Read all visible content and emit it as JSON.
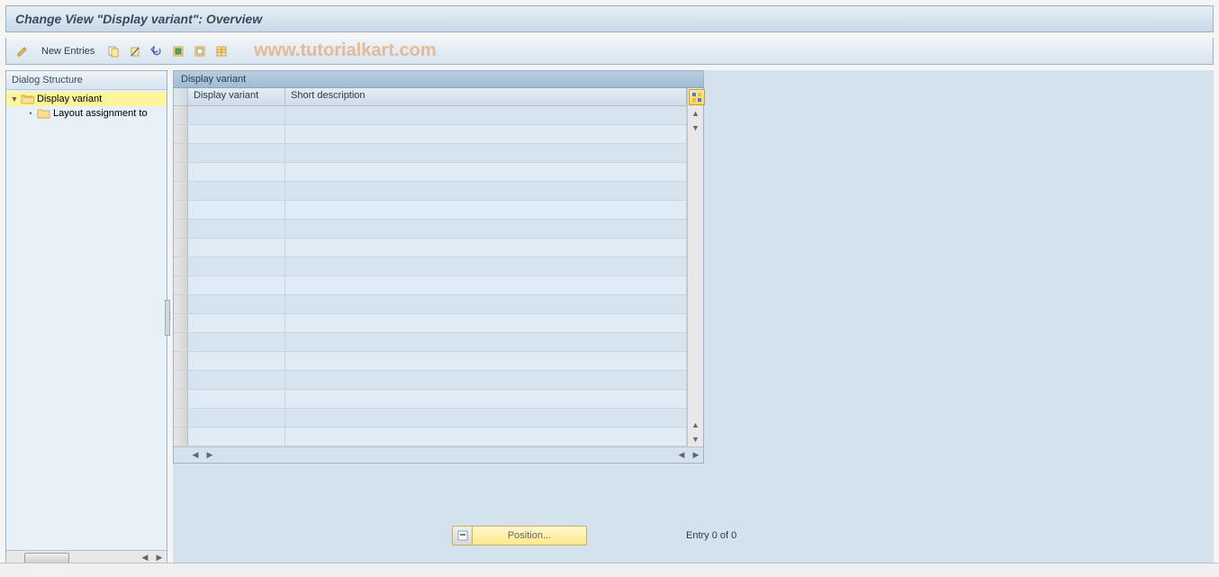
{
  "title": "Change View \"Display variant\": Overview",
  "toolbar": {
    "new_entries_label": "New Entries"
  },
  "watermark": "www.tutorialkart.com",
  "tree": {
    "header": "Dialog Structure",
    "items": [
      {
        "label": "Display variant",
        "level": 0,
        "expanded": true,
        "selected": true,
        "icon": "folder-open"
      },
      {
        "label": "Layout assignment to",
        "level": 1,
        "expanded": false,
        "selected": false,
        "icon": "folder"
      }
    ]
  },
  "table": {
    "title": "Display variant",
    "columns": [
      "Display variant",
      "Short description"
    ],
    "row_count": 18
  },
  "footer": {
    "position_label": "Position...",
    "entry_text": "Entry 0 of 0"
  }
}
